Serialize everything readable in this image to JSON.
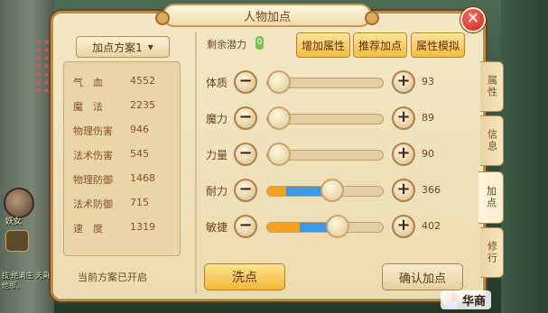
{
  "window": {
    "title": "人物加点",
    "close_label": "✕"
  },
  "scheme": {
    "selected": "加点方案1",
    "status": "当前方案已开启"
  },
  "stats": [
    {
      "name": "气　血",
      "value": "4552"
    },
    {
      "name": "魔　法",
      "value": "2235"
    },
    {
      "name": "物理伤害",
      "value": "946"
    },
    {
      "name": "法术伤害",
      "value": "545"
    },
    {
      "name": "物理防御",
      "value": "1468"
    },
    {
      "name": "法术防御",
      "value": "715"
    },
    {
      "name": "速　度",
      "value": "1319"
    }
  ],
  "remaining": {
    "label": "剩余潜力",
    "value": "0"
  },
  "buttons": {
    "add": "增加属性",
    "recommend": "推荐加点",
    "simulate": "属性模拟",
    "wash": "洗点",
    "confirm": "确认加点"
  },
  "attributes": [
    {
      "name": "体质",
      "value": "93",
      "base_fraction": 0.08,
      "allocated_fraction": 0.0
    },
    {
      "name": "魔力",
      "value": "89",
      "base_fraction": 0.07,
      "allocated_fraction": 0.0
    },
    {
      "name": "力量",
      "value": "90",
      "base_fraction": 0.07,
      "allocated_fraction": 0.0
    },
    {
      "name": "耐力",
      "value": "366",
      "base_fraction": 0.16,
      "allocated_fraction": 0.39
    },
    {
      "name": "敏捷",
      "value": "402",
      "base_fraction": 0.28,
      "allocated_fraction": 0.32
    }
  ],
  "side_tabs": [
    {
      "label": "属性",
      "active": false
    },
    {
      "label": "信息",
      "active": false
    },
    {
      "label": "加点",
      "active": true
    },
    {
      "label": "修行",
      "active": false
    }
  ],
  "background": {
    "avatar_label": "妖女",
    "chat_text": "技·绝满庄 天哥他那。"
  },
  "watermark": "华商",
  "colors": {
    "accent": "#f3b737",
    "panel": "#f3e7c6",
    "fill_base": "#f4a11e",
    "fill_added": "#3c98e3"
  }
}
